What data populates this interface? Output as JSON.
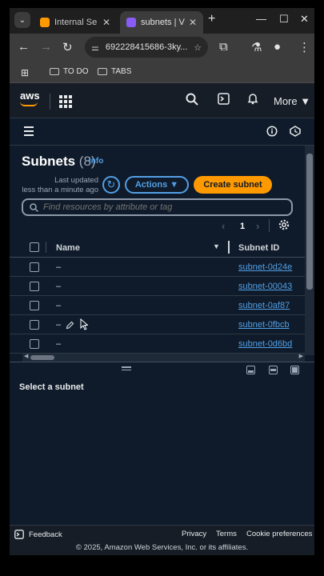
{
  "browser": {
    "tabs": [
      {
        "title": "Internal Se",
        "active": false,
        "favicon_color": "#ff9900"
      },
      {
        "title": "subnets | V",
        "active": true,
        "favicon_color": "#8a5cf6"
      }
    ],
    "new_tab": "+",
    "window_controls": {
      "minimize": "—",
      "maximize": "☐",
      "close": "✕"
    },
    "url": "692228415686-3ky...",
    "bookmarks": [
      "TO DO",
      "TABS"
    ]
  },
  "aws": {
    "logo_text": "aws",
    "more_label": "More ▼"
  },
  "subnets": {
    "title": "Subnets",
    "count": "(8)",
    "info_label": "Info",
    "last_updated_line1": "Last updated",
    "last_updated_line2": "less than a minute ago",
    "actions_label": "Actions ▼",
    "create_label": "Create subnet",
    "search_placeholder": "Find resources by attribute or tag",
    "page_number": "1",
    "columns": {
      "name": "Name",
      "subnet_id": "Subnet ID"
    },
    "rows": [
      {
        "name": "–",
        "id": "subnet-0d24e"
      },
      {
        "name": "–",
        "id": "subnet-00043"
      },
      {
        "name": "–",
        "id": "subnet-0af87"
      },
      {
        "name": "–",
        "id": "subnet-0fbcb"
      },
      {
        "name": "–",
        "id": "subnet-0d6bd"
      }
    ]
  },
  "detail": {
    "message": "Select a subnet"
  },
  "footer": {
    "feedback": "Feedback",
    "privacy": "Privacy",
    "terms": "Terms",
    "cookies": "Cookie preferences",
    "copyright": "© 2025, Amazon Web Services, Inc. or its affiliates."
  }
}
